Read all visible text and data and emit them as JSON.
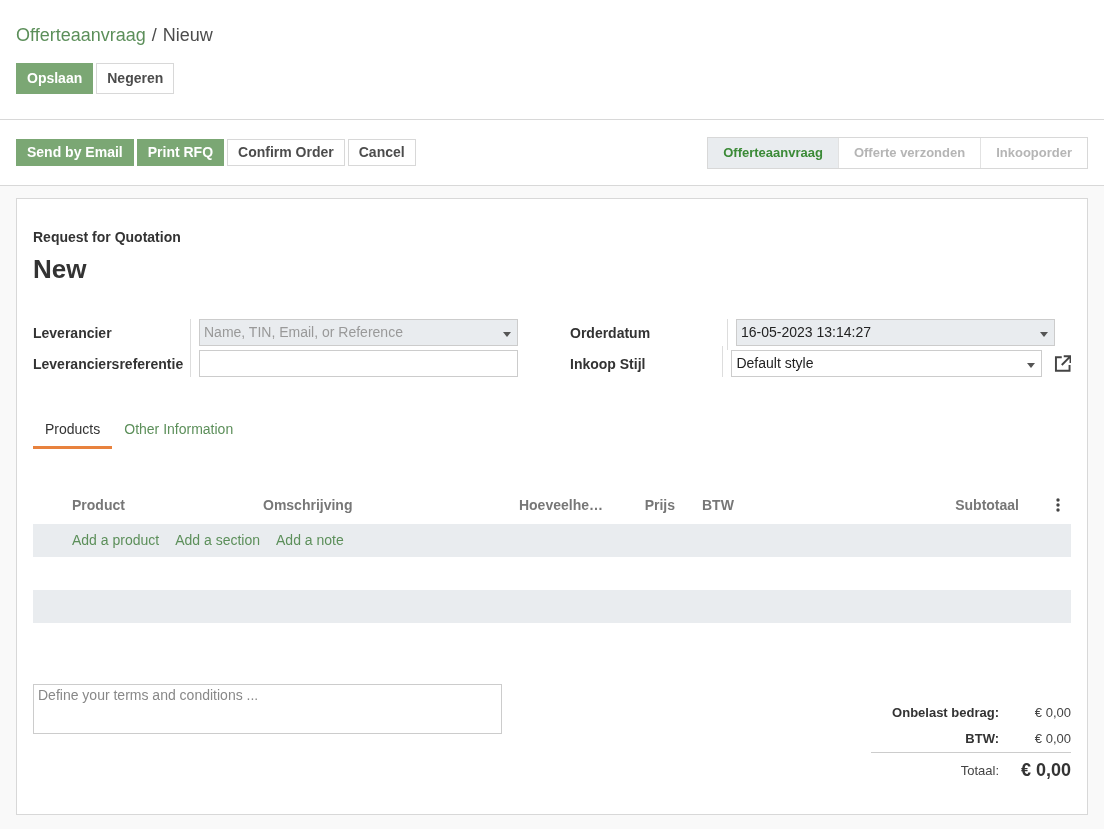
{
  "breadcrumb": {
    "parent": "Offerteaanvraag",
    "separator": "/",
    "current": "Nieuw"
  },
  "form_buttons": [
    {
      "label": "Opslaan",
      "kind": "primary"
    },
    {
      "label": "Negeren",
      "kind": "secondary"
    }
  ],
  "action_buttons": [
    {
      "label": "Send by Email",
      "kind": "primary"
    },
    {
      "label": "Print RFQ",
      "kind": "primary"
    },
    {
      "label": "Confirm Order",
      "kind": "secondary"
    },
    {
      "label": "Cancel",
      "kind": "secondary"
    }
  ],
  "status_steps": [
    {
      "label": "Offerteaanvraag",
      "selected": true
    },
    {
      "label": "Offerte verzonden",
      "selected": false
    },
    {
      "label": "Inkooporder",
      "selected": false
    }
  ],
  "document": {
    "subtitle": "Request for Quotation",
    "title": "New"
  },
  "left_fields": [
    {
      "label": "Leverancier",
      "kind": "select",
      "required": true,
      "placeholder": "Name, TIN, Email, or Reference"
    },
    {
      "label": "Leveranciersreferentie",
      "kind": "text",
      "required": false
    }
  ],
  "right_fields": [
    {
      "label": "Orderdatum",
      "kind": "select",
      "required": true,
      "value": "16-05-2023 13:14:27",
      "external_link": false
    },
    {
      "label": "Inkoop Stijl",
      "kind": "select",
      "required": false,
      "value": "Default style",
      "external_link": true
    }
  ],
  "tabs": [
    {
      "label": "Products",
      "selected": true
    },
    {
      "label": "Other Information",
      "selected": false
    }
  ],
  "table": {
    "columns": [
      "Product",
      "Omschrijving",
      "Hoeveelhe…",
      "Prijs",
      "BTW",
      "Subtotaal"
    ],
    "add_links": [
      "Add a product",
      "Add a section",
      "Add a note"
    ]
  },
  "terms": {
    "placeholder": "Define your terms and conditions ..."
  },
  "totals": [
    {
      "label": "Onbelast bedrag:",
      "value": "€ 0,00",
      "kind": "line"
    },
    {
      "label": "BTW:",
      "value": "€ 0,00",
      "kind": "line"
    },
    {
      "label": "Totaal:",
      "value": "€ 0,00",
      "kind": "total"
    }
  ]
}
